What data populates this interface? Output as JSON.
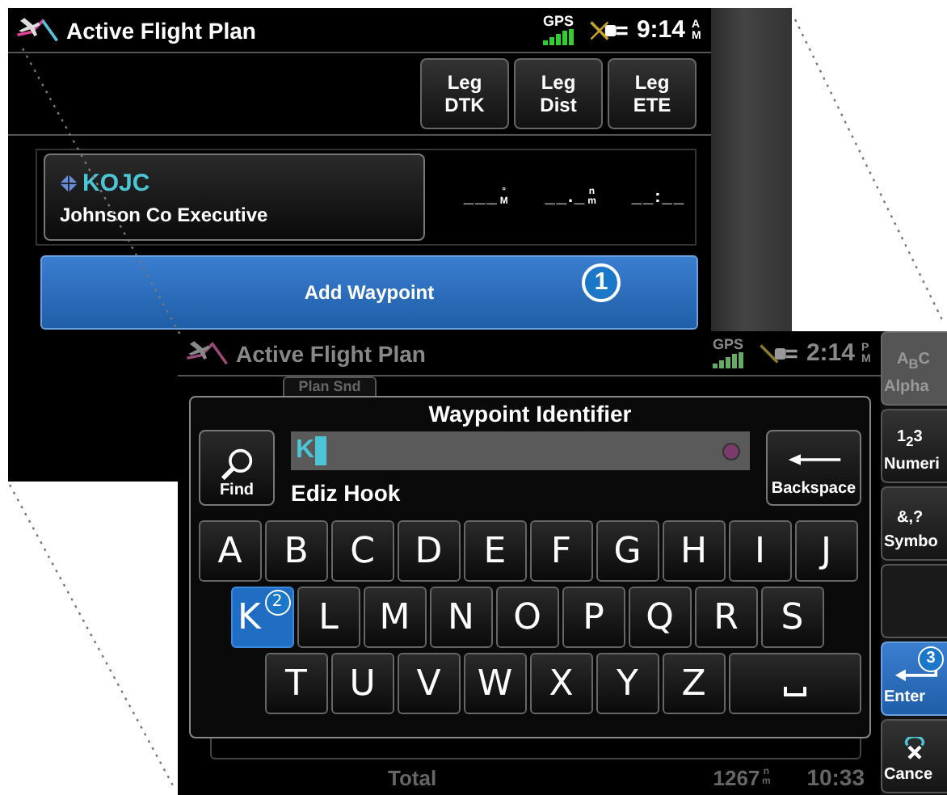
{
  "flight_plan_screen": {
    "title": "Active Flight Plan",
    "gps_label": "GPS",
    "time": "9:14",
    "meridiem": "AM",
    "column_buttons": [
      {
        "top": "Leg",
        "bottom": "DTK"
      },
      {
        "top": "Leg",
        "bottom": "Dist"
      },
      {
        "top": "Leg",
        "bottom": "ETE"
      }
    ],
    "waypoint": {
      "identifier": "KOJC",
      "name": "Johnson Co Executive"
    },
    "leg_values": [
      {
        "value": "___",
        "unit": "°M"
      },
      {
        "value": "__._",
        "unit": "nm"
      },
      {
        "value": "__:__"
      }
    ],
    "add_button": {
      "label": "Add Waypoint",
      "callout": "1"
    }
  },
  "keyboard_screen": {
    "title": "Active Flight Plan",
    "gps_label": "GPS",
    "time": "2:14",
    "meridiem": "PM",
    "background_button": "Plan Snd",
    "dialog": {
      "title": "Waypoint Identifier",
      "find_label": "Find",
      "input_value": "K",
      "match_name": "Ediz Hook",
      "backspace_label": "Backspace",
      "key_rows": [
        [
          {
            "kind": "letter",
            "label": "A",
            "selected": false
          },
          {
            "kind": "letter",
            "label": "B",
            "selected": false
          },
          {
            "kind": "letter",
            "label": "C",
            "selected": false
          },
          {
            "kind": "letter",
            "label": "D",
            "selected": false
          },
          {
            "kind": "letter",
            "label": "E",
            "selected": false
          },
          {
            "kind": "letter",
            "label": "F",
            "selected": false
          },
          {
            "kind": "letter",
            "label": "G",
            "selected": false
          },
          {
            "kind": "letter",
            "label": "H",
            "selected": false
          },
          {
            "kind": "letter",
            "label": "I",
            "selected": false
          },
          {
            "kind": "letter",
            "label": "J",
            "selected": false
          }
        ],
        [
          {
            "kind": "letter",
            "label": "K",
            "selected": true,
            "callout": "2"
          },
          {
            "kind": "letter",
            "label": "L",
            "selected": false
          },
          {
            "kind": "letter",
            "label": "M",
            "selected": false
          },
          {
            "kind": "letter",
            "label": "N",
            "selected": false
          },
          {
            "kind": "letter",
            "label": "O",
            "selected": false
          },
          {
            "kind": "letter",
            "label": "P",
            "selected": false
          },
          {
            "kind": "letter",
            "label": "Q",
            "selected": false
          },
          {
            "kind": "letter",
            "label": "R",
            "selected": false
          },
          {
            "kind": "letter",
            "label": "S",
            "selected": false
          }
        ],
        [
          {
            "kind": "letter",
            "label": "T",
            "selected": false
          },
          {
            "kind": "letter",
            "label": "U",
            "selected": false
          },
          {
            "kind": "letter",
            "label": "V",
            "selected": false
          },
          {
            "kind": "letter",
            "label": "W",
            "selected": false
          },
          {
            "kind": "letter",
            "label": "X",
            "selected": false
          },
          {
            "kind": "letter",
            "label": "Y",
            "selected": false
          },
          {
            "kind": "letter",
            "label": "Z",
            "selected": false
          },
          {
            "kind": "space",
            "selected": false
          }
        ]
      ]
    },
    "footer": {
      "label": "Total",
      "distance": "1267",
      "distance_unit": "nm",
      "time": "10:33"
    },
    "side_buttons": [
      {
        "kind": "alpha",
        "icon_text": "A$_{B}$C",
        "label": "Alpha",
        "disabled": true,
        "selected": false
      },
      {
        "kind": "numeric",
        "icon_text": "1$_{2}$3",
        "label": "Numeri",
        "disabled": false,
        "selected": false
      },
      {
        "kind": "symbol",
        "icon_text": "&,?",
        "label": "Symbo",
        "disabled": false,
        "selected": false
      },
      {
        "kind": "blank",
        "disabled": false,
        "selected": false
      },
      {
        "kind": "enter",
        "label": "Enter",
        "disabled": false,
        "selected": true,
        "callout": "3"
      },
      {
        "kind": "cancel",
        "label": "Cance",
        "disabled": false,
        "selected": false
      }
    ]
  }
}
